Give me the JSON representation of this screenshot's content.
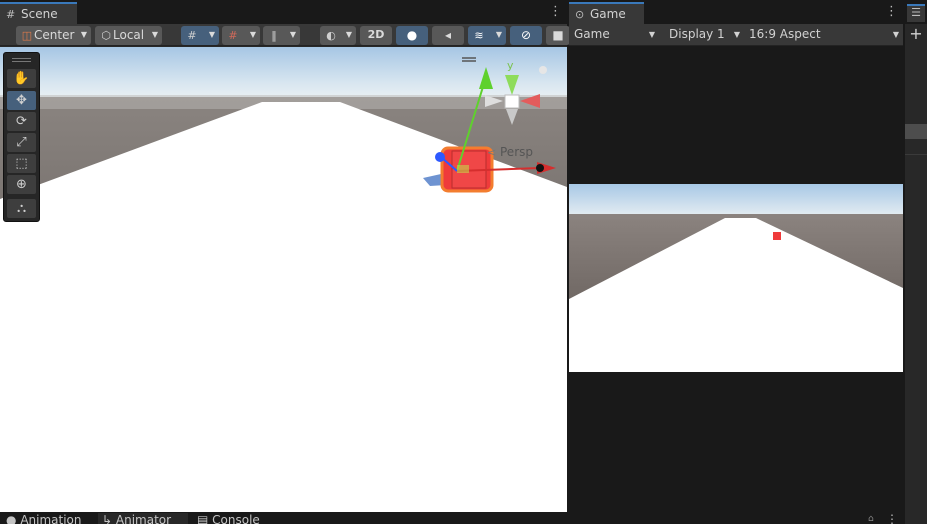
{
  "scene": {
    "tab_label": "Scene",
    "tab_icon": "grid-icon",
    "pivot_mode": "Center",
    "pivot_rotation": "Local",
    "mode_2d": "2D",
    "gizmo_persp_label": "Persp",
    "gizmo_axis_y": "y"
  },
  "game": {
    "tab_label": "Game",
    "tab_icon": "gamepad-icon",
    "view_mode": "Game",
    "display": "Display 1",
    "aspect": "16:9 Aspect"
  },
  "bottom_tabs": [
    {
      "label": "Animation",
      "icon": "animation-icon"
    },
    {
      "label": "Animator",
      "icon": "animator-icon"
    },
    {
      "label": "Console",
      "icon": "console-icon"
    }
  ],
  "colors": {
    "accent_tab": "#3a79bb",
    "selection_orange": "#f37d2f",
    "cube_red": "#ef3b3b",
    "axis_green": "#5fd12d",
    "axis_red": "#d52e2e",
    "axis_blue": "#2e59ff"
  }
}
